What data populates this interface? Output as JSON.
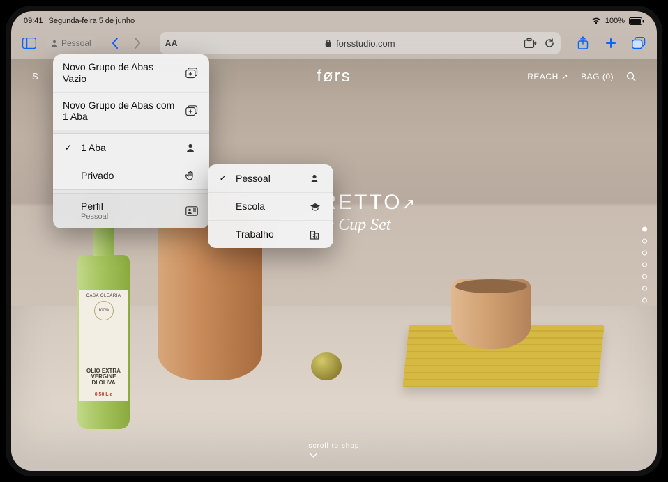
{
  "status": {
    "time": "09:41",
    "date": "Segunda-feira 5 de junho",
    "battery": "100%"
  },
  "toolbar": {
    "profile_label": "Pessoal",
    "aa_label": "AA",
    "url": "forsstudio.com"
  },
  "site": {
    "logo": "førs",
    "nav_left": "S",
    "nav_reach": "REACH ↗",
    "nav_bag": "BAG (0)",
    "hero_line1": "RETTO",
    "hero_line2": "& Cup Set",
    "scroll": "scroll to shop"
  },
  "bottle_label": {
    "brand": "CASA OLEARIA",
    "circle": "100%",
    "big1": "OLIO EXTRA",
    "big2": "VERGINE",
    "big3": "DI OLIVA",
    "vol": "0,50 L e"
  },
  "menu1": {
    "new_empty": "Novo Grupo de Abas Vazio",
    "new_with": "Novo Grupo de Abas com 1 Aba",
    "one_tab": "1 Aba",
    "private": "Privado",
    "profile": "Perfil",
    "profile_sub": "Pessoal"
  },
  "menu2": {
    "personal": "Pessoal",
    "school": "Escola",
    "work": "Trabalho"
  }
}
